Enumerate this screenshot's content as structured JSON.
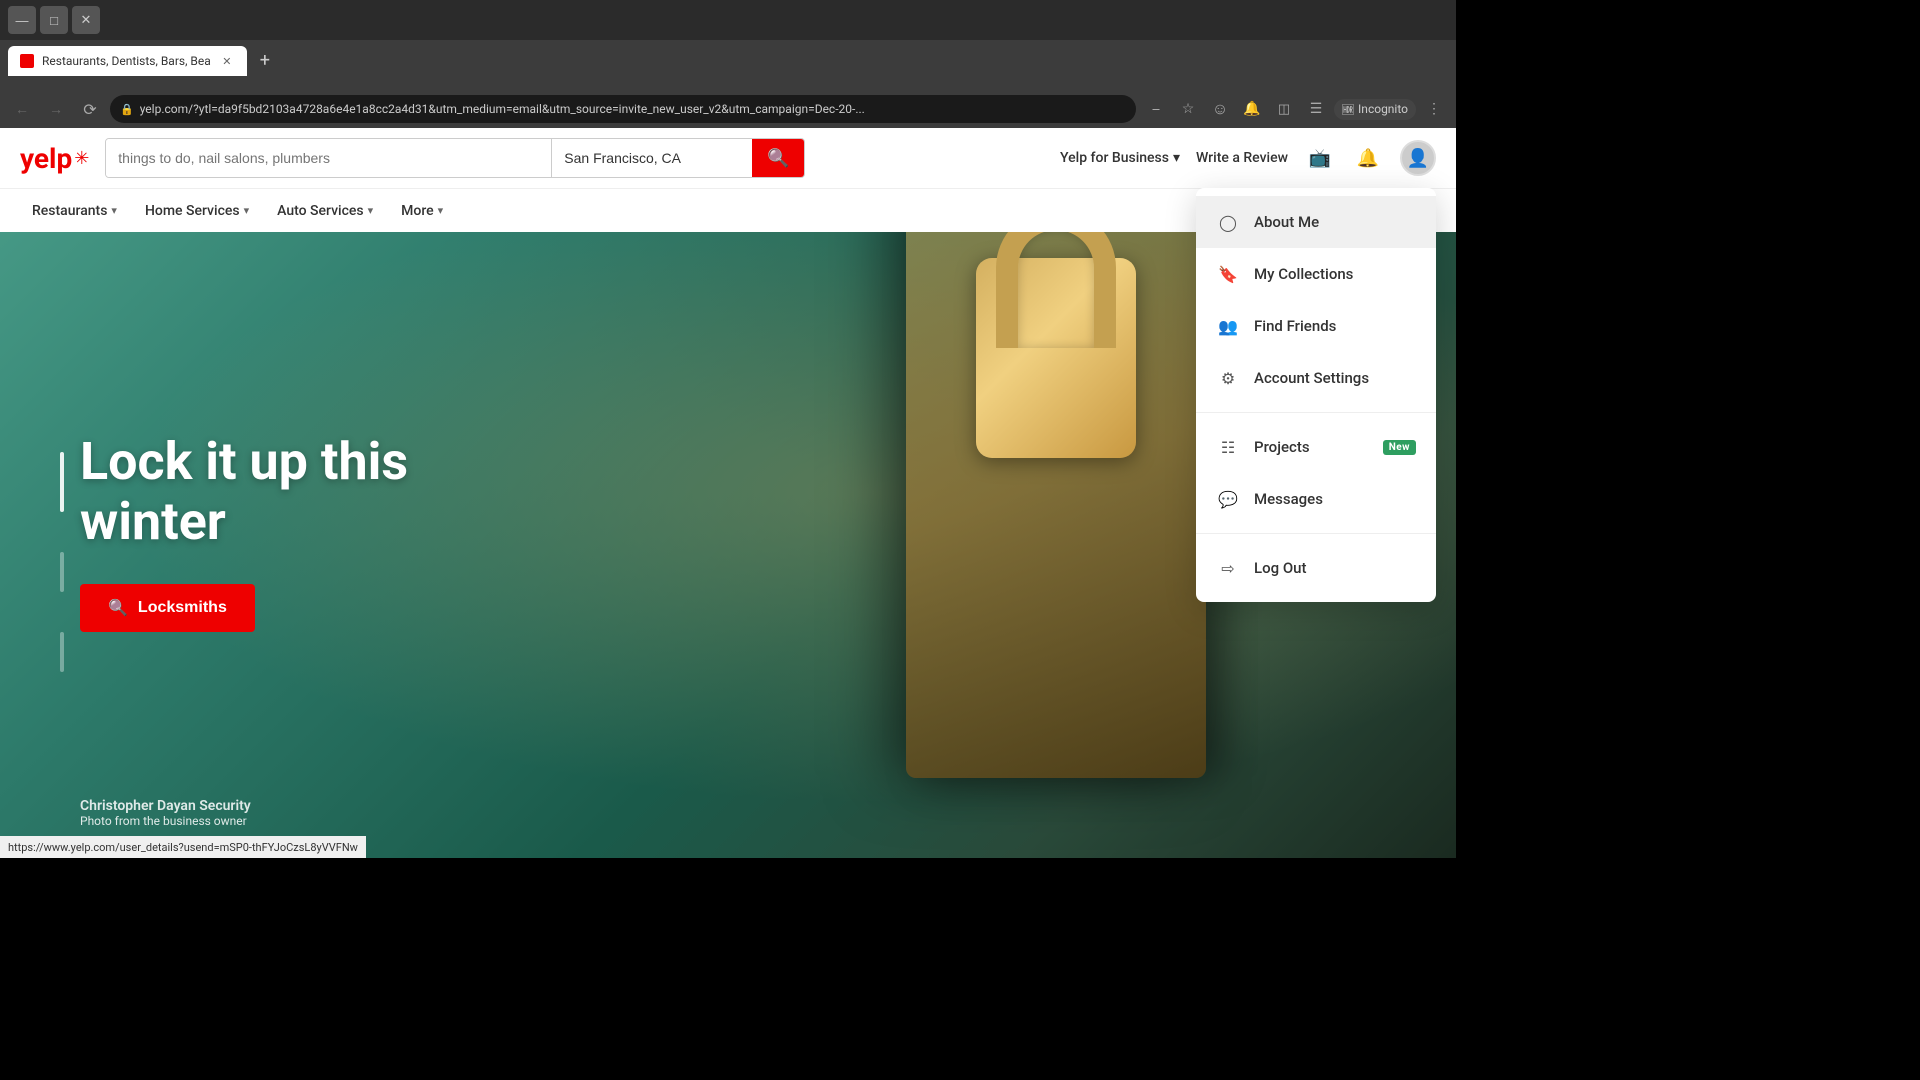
{
  "browser": {
    "tab_title": "Restaurants, Dentists, Bars, Bea",
    "url": "yelp.com/?ytl=da9f5bd2103a4728a6e4e1a8cc2a4d318utm_medium=email&utm_source=invite_new_user_v2&utm_campaign=Dec-20-...",
    "full_url": "yelp.com/?ytl=da9f5bd2103a4728a6e4e1a8cc2a4d31&utm_medium=email&utm_source=invite_new_user_v2&utm_campaign=Dec-20-...",
    "incognito_label": "Incognito",
    "status_url": "https://www.yelp.com/user_details?usend=mSP0-thFYJoCzsL8yVVFNw"
  },
  "header": {
    "logo_text": "yelp",
    "search_placeholder": "things to do, nail salons, plumbers",
    "search_location": "San Francisco, CA",
    "yelp_for_business": "Yelp for Business",
    "write_review": "Write a Review"
  },
  "nav": {
    "items": [
      {
        "label": "Restaurants",
        "id": "restaurants"
      },
      {
        "label": "Home Services",
        "id": "home-services"
      },
      {
        "label": "Auto Services",
        "id": "auto-services"
      },
      {
        "label": "More",
        "id": "more"
      }
    ]
  },
  "hero": {
    "title_line1": "Lock it up this",
    "title_line2": "winter",
    "cta_label": "Locksmiths",
    "photo_credit_name": "Christopher Dayan Security",
    "photo_credit_sub": "Photo from the business owner"
  },
  "dropdown": {
    "items": [
      {
        "label": "About Me",
        "icon": "user-circle",
        "id": "about-me",
        "hovered": true
      },
      {
        "label": "My Collections",
        "icon": "bookmark",
        "id": "my-collections",
        "hovered": false
      },
      {
        "label": "Find Friends",
        "icon": "user-plus",
        "id": "find-friends",
        "hovered": false
      },
      {
        "label": "Account Settings",
        "icon": "gear",
        "id": "account-settings",
        "hovered": false
      }
    ],
    "items2": [
      {
        "label": "Projects",
        "icon": "grid",
        "id": "projects",
        "badge": "New"
      },
      {
        "label": "Messages",
        "icon": "chat",
        "id": "messages"
      }
    ],
    "items3": [
      {
        "label": "Log Out",
        "icon": "logout",
        "id": "log-out"
      }
    ]
  }
}
